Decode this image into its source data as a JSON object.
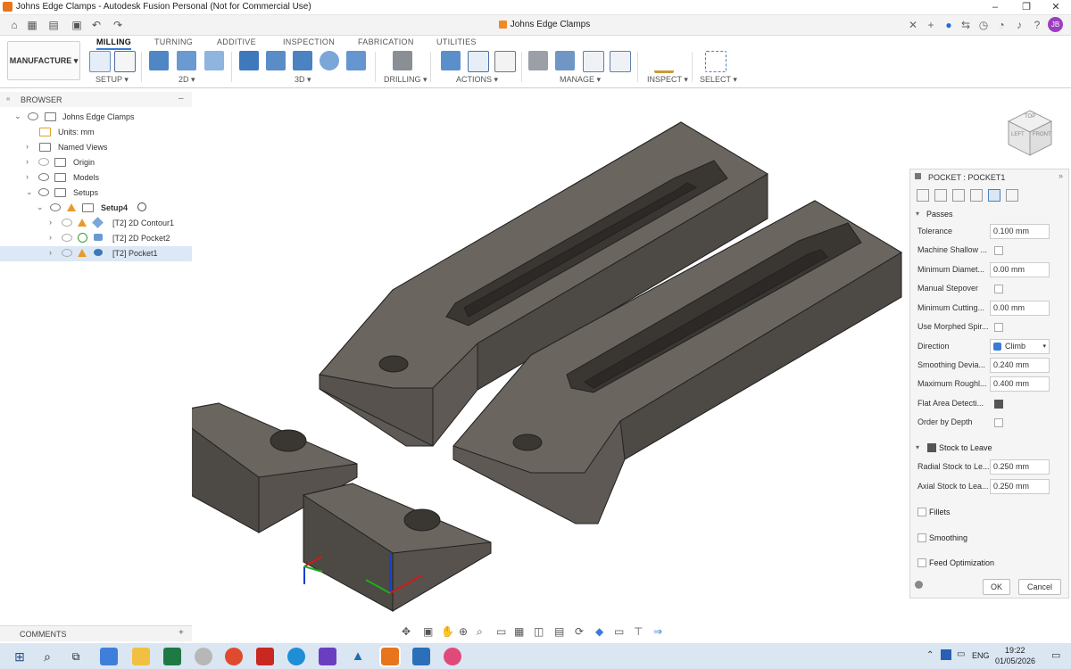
{
  "window": {
    "title": "Johns Edge Clamps - Autodesk Fusion Personal (Not for Commercial Use)",
    "controls": {
      "minimize": "–",
      "restore": "❐",
      "close": "✕"
    }
  },
  "document_tab": {
    "title": "Johns Edge Clamps",
    "close": "✕",
    "add": "+"
  },
  "user": {
    "initials": "JB"
  },
  "ribbon": {
    "workspace": "MANUFACTURE",
    "tabs": [
      "MILLING",
      "TURNING",
      "ADDITIVE",
      "INSPECTION",
      "FABRICATION",
      "UTILITIES"
    ],
    "active_tab": "MILLING",
    "groups": [
      "SETUP",
      "2D",
      "3D",
      "DRILLING",
      "ACTIONS",
      "MANAGE",
      "INSPECT",
      "SELECT"
    ]
  },
  "browser": {
    "header": "BROWSER",
    "items": [
      {
        "label": "Johns Edge Clamps"
      },
      {
        "label": "Units: mm"
      },
      {
        "label": "Named Views"
      },
      {
        "label": "Origin"
      },
      {
        "label": "Models"
      },
      {
        "label": "Setups"
      },
      {
        "label": "Setup4"
      },
      {
        "label": "[T2] 2D Contour1"
      },
      {
        "label": "[T2] 2D Pocket2"
      },
      {
        "label": "[T2] Pocket1"
      }
    ]
  },
  "viewcube": {
    "left": "LEFT",
    "front": "FRONT",
    "top": "TOP"
  },
  "panel": {
    "title": "POCKET : POCKET1",
    "sections": {
      "passes": "Passes",
      "stock": "Stock to Leave",
      "fillets": "Fillets",
      "smoothing": "Smoothing",
      "feed": "Feed Optimization"
    },
    "passes_rows": [
      {
        "label": "Tolerance",
        "value": "0.100 mm"
      },
      {
        "label": "Machine Shallow ...",
        "checked": false
      },
      {
        "label": "Minimum Diamet...",
        "value": "0.00 mm"
      },
      {
        "label": "Manual Stepover",
        "checked": false
      },
      {
        "label": "Minimum Cutting...",
        "value": "0.00 mm"
      },
      {
        "label": "Use Morphed Spir...",
        "checked": false
      },
      {
        "label": "Direction",
        "value": "Climb"
      },
      {
        "label": "Smoothing Devia...",
        "value": "0.240 mm"
      },
      {
        "label": "Maximum Roughl...",
        "value": "0.400 mm"
      },
      {
        "label": "Flat Area Detecti...",
        "checked": true
      },
      {
        "label": "Order by Depth",
        "checked": false
      }
    ],
    "stock_rows": [
      {
        "label": "Radial Stock to Le...",
        "value": "0.250 mm"
      },
      {
        "label": "Axial Stock to Lea...",
        "value": "0.250 mm"
      }
    ],
    "ok": "OK",
    "cancel": "Cancel"
  },
  "comments": {
    "label": "COMMENTS",
    "add": "+"
  },
  "taskbar": {
    "language": "ENG",
    "time": "19:22",
    "date": "01/05/2026"
  }
}
